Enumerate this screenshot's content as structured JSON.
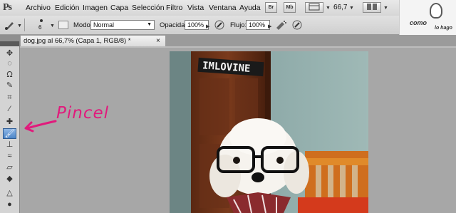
{
  "app": {
    "logo_text": "Ps"
  },
  "menu": [
    "Archivo",
    "Edición",
    "Imagen",
    "Capa",
    "Selección",
    "Filtro",
    "Vista",
    "Ventana",
    "Ayuda"
  ],
  "menubar_buttons": [
    "Br",
    "Mb"
  ],
  "zoom": "66,7",
  "brand": {
    "line1": "como",
    "line2": "lo hago"
  },
  "options": {
    "brush_size": "6",
    "mode_label": "Modo:",
    "mode_value": "Normal",
    "opacity_label": "Opacidad:",
    "opacity_value": "100%",
    "flow_label": "Flujo:",
    "flow_value": "100%"
  },
  "document": {
    "tab_title": "dog.jpg al 66,7% (Capa 1, RGB/8) *",
    "close_glyph": "×"
  },
  "photo_sign": "IMLOVINE",
  "annotation": "Pincel",
  "tools": [
    {
      "name": "move-tool-icon",
      "glyph": "✥"
    },
    {
      "name": "marquee-tool-icon",
      "glyph": "◌"
    },
    {
      "name": "lasso-tool-icon",
      "glyph": "ᘯ"
    },
    {
      "name": "quick-select-tool-icon",
      "glyph": "✎"
    },
    {
      "name": "crop-tool-icon",
      "glyph": "⌗"
    },
    {
      "name": "eyedropper-tool-icon",
      "glyph": "⁄"
    },
    {
      "name": "healing-tool-icon",
      "glyph": "✚"
    },
    {
      "name": "brush-tool-icon",
      "glyph": "🖌"
    },
    {
      "name": "stamp-tool-icon",
      "glyph": "⊥"
    },
    {
      "name": "history-brush-tool-icon",
      "glyph": "≈"
    },
    {
      "name": "eraser-tool-icon",
      "glyph": "▱"
    },
    {
      "name": "bucket-tool-icon",
      "glyph": "◆"
    },
    {
      "name": "blur-tool-icon",
      "glyph": "△"
    },
    {
      "name": "dodge-tool-icon",
      "glyph": "●"
    }
  ]
}
